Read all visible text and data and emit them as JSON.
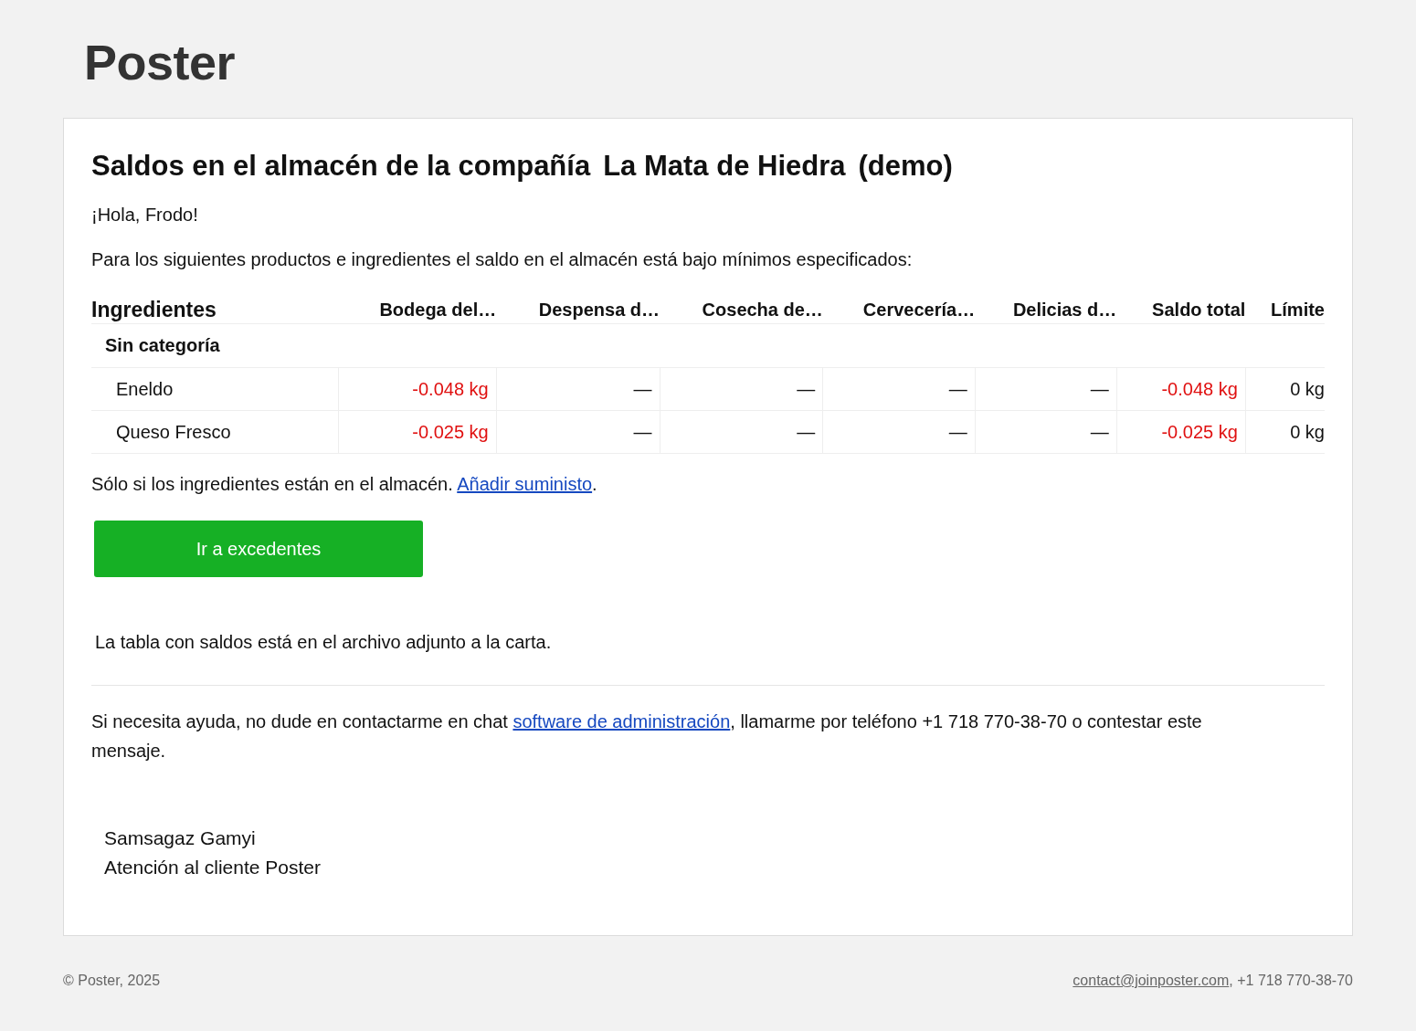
{
  "logo": "Poster",
  "title": {
    "prefix": "Saldos en el almacén de la compañía",
    "company": "La Mata de Hiedra",
    "suffix": "(demo)"
  },
  "greeting": "¡Hola, Frodo!",
  "intro": "Para los siguientes productos e ingredientes el saldo en el almacén está bajo mínimos especificados:",
  "table": {
    "columns": [
      "Ingredientes",
      "Bodega del…",
      "Despensa d…",
      "Cosecha de…",
      "Cervecería…",
      "Delicias d…",
      "Saldo total",
      "Límite"
    ],
    "groups": [
      {
        "name": "Sin categoría",
        "rows": [
          {
            "name": "Eneldo",
            "cells": [
              {
                "text": "-0.048 kg",
                "below_minimum": true
              },
              {
                "text": "—",
                "below_minimum": false
              },
              {
                "text": "—",
                "below_minimum": false
              },
              {
                "text": "—",
                "below_minimum": false
              },
              {
                "text": "—",
                "below_minimum": false
              },
              {
                "text": "-0.048 kg",
                "below_minimum": true
              },
              {
                "text": "0 kg",
                "below_minimum": false
              }
            ]
          },
          {
            "name": "Queso Fresco",
            "cells": [
              {
                "text": "-0.025 kg",
                "below_minimum": true
              },
              {
                "text": "—",
                "below_minimum": false
              },
              {
                "text": "—",
                "below_minimum": false
              },
              {
                "text": "—",
                "below_minimum": false
              },
              {
                "text": "—",
                "below_minimum": false
              },
              {
                "text": "-0.025 kg",
                "below_minimum": true
              },
              {
                "text": "0 kg",
                "below_minimum": false
              }
            ]
          }
        ]
      }
    ]
  },
  "note": {
    "text": "Sólo si los ingredientes están en el almacén.",
    "link": "Añadir suministo",
    "end": "."
  },
  "button": "Ir a excedentes",
  "attachment_note": "La tabla con saldos está en el archivo adjunto a la carta.",
  "help": {
    "before": "Si necesita ayuda, no dude en contactarme en chat",
    "link": "software de administración",
    "after": ", llamarme por teléfono +1 718 770-38-70 o contestar este mensaje."
  },
  "signature": {
    "name": "Samsagaz Gamyi",
    "role": "Atención al cliente Poster"
  },
  "footer": {
    "copyright": "© Poster, 2025",
    "email": "contact@joinposter.com",
    "phone": ", +1 718 770-38-70"
  }
}
